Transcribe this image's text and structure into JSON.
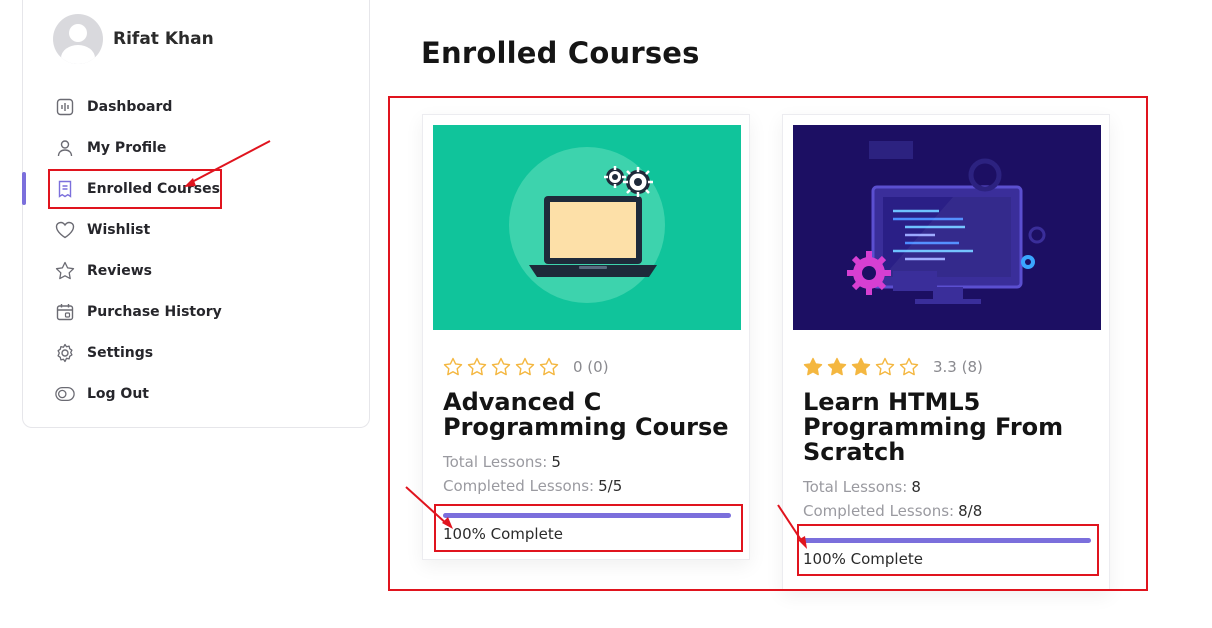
{
  "user": {
    "name": "Rifat Khan"
  },
  "sidebar": {
    "items": [
      {
        "label": "Dashboard",
        "icon": "dashboard-icon"
      },
      {
        "label": "My Profile",
        "icon": "user-icon"
      },
      {
        "label": "Enrolled Courses",
        "icon": "course-icon",
        "active": true
      },
      {
        "label": "Wishlist",
        "icon": "heart-icon"
      },
      {
        "label": "Reviews",
        "icon": "star-icon"
      },
      {
        "label": "Purchase History",
        "icon": "calendar-icon"
      },
      {
        "label": "Settings",
        "icon": "gear-icon"
      },
      {
        "label": "Log Out",
        "icon": "logout-icon"
      }
    ]
  },
  "main": {
    "title": "Enrolled Courses",
    "courses": [
      {
        "title": "Advanced C Programming Course",
        "rating_text": "0 (0)",
        "rating_value": 0,
        "total_lessons_label": "Total Lessons:",
        "total_lessons": "5",
        "completed_lessons_label": "Completed Lessons:",
        "completed_lessons": "5/5",
        "progress_text": "100% Complete",
        "progress": 1.0,
        "thumbnail": "laptop-gears-illustration"
      },
      {
        "title": "Learn HTML5 Programming From Scratch",
        "rating_text": "3.3 (8)",
        "rating_value": 3,
        "total_lessons_label": "Total Lessons:",
        "total_lessons": "8",
        "completed_lessons_label": "Completed Lessons:",
        "completed_lessons": "8/8",
        "progress_text": "100% Complete",
        "progress": 1.0,
        "thumbnail": "code-monitor-illustration"
      }
    ]
  },
  "colors": {
    "accent": "#7b6fdc",
    "star": "#f4b740",
    "annotation": "#e0141e",
    "card1_bg": "#10c49b",
    "card2_bg": "#1c0f63"
  }
}
